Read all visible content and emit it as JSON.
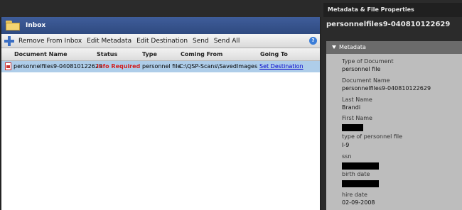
{
  "inbox": {
    "title": "Inbox"
  },
  "toolbar": {
    "add_icon": "add-plus-icon",
    "remove_from_inbox": "Remove From Inbox",
    "edit_metadata": "Edit Metadata",
    "edit_destination": "Edit Destination",
    "send": "Send",
    "send_all": "Send All",
    "help_icon": "help-icon"
  },
  "grid": {
    "columns": [
      "Document Name",
      "Status",
      "Type",
      "Coming From",
      "Going To"
    ],
    "rows": [
      {
        "document_name": "personnelfiles9-040810122629",
        "status": "Info Required",
        "type": "personnel file",
        "coming_from": "C:\\QSP-Scans\\SavedImages",
        "going_to": "Set Destination"
      }
    ]
  },
  "metadata_panel": {
    "title": "Metadata & File Properties",
    "filename": "personnelfiles9-040810122629",
    "section_label": "Metadata",
    "fields": [
      {
        "label": "Type of Document",
        "value": "personnel file"
      },
      {
        "label": "Document Name",
        "value": "personnelfiles9-040810122629"
      },
      {
        "label": "Last Name",
        "value": "Brandi"
      },
      {
        "label": "First Name",
        "value": ""
      },
      {
        "label": "type of personnel file",
        "value": "I-9"
      },
      {
        "label": "ssn",
        "value": ""
      },
      {
        "label": "birth date",
        "value": ""
      },
      {
        "label": "hire date",
        "value": "02-09-2008"
      }
    ]
  },
  "colors": {
    "header_blue": "#34508a",
    "selection_blue": "#aecde9",
    "status_red": "#d21d1d",
    "link_blue": "#0000cc"
  }
}
